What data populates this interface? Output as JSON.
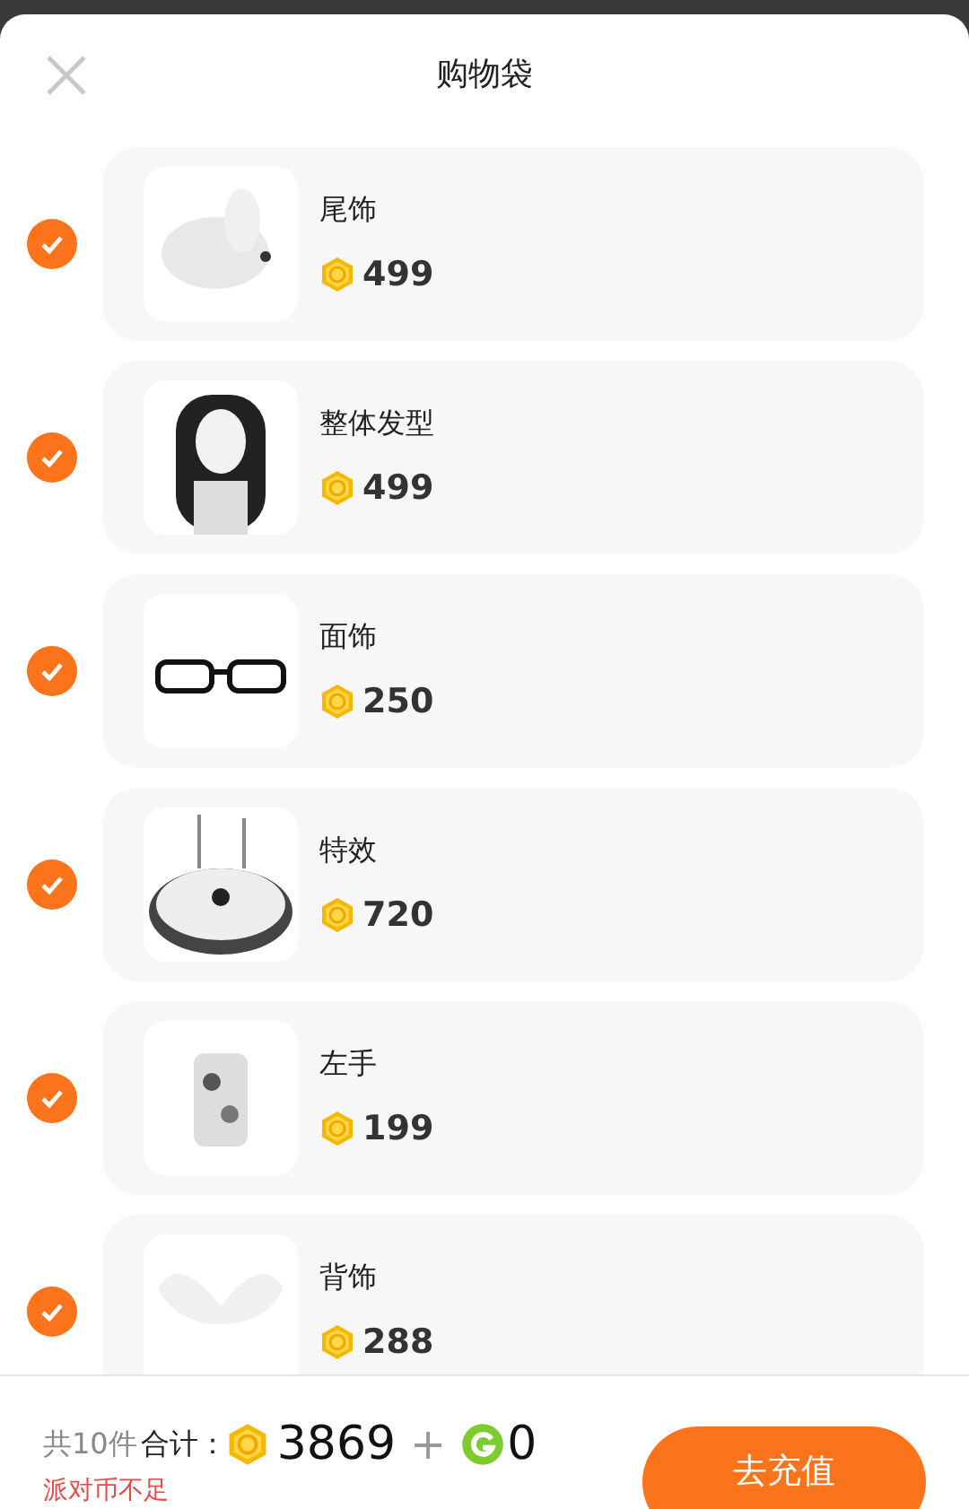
{
  "header": {
    "title": "购物袋"
  },
  "items": [
    {
      "name": "尾饰",
      "price": "499",
      "selected": true
    },
    {
      "name": "整体发型",
      "price": "499",
      "selected": true
    },
    {
      "name": "面饰",
      "price": "250",
      "selected": true
    },
    {
      "name": "特效",
      "price": "720",
      "selected": true
    },
    {
      "name": "左手",
      "price": "199",
      "selected": true
    },
    {
      "name": "背饰",
      "price": "288",
      "selected": true
    }
  ],
  "footer": {
    "count": "共10件",
    "total_label": "合计：",
    "gold_total": "3869",
    "plus": "+",
    "green_total": "0",
    "warning": "派对币不足",
    "button": "去充值"
  }
}
